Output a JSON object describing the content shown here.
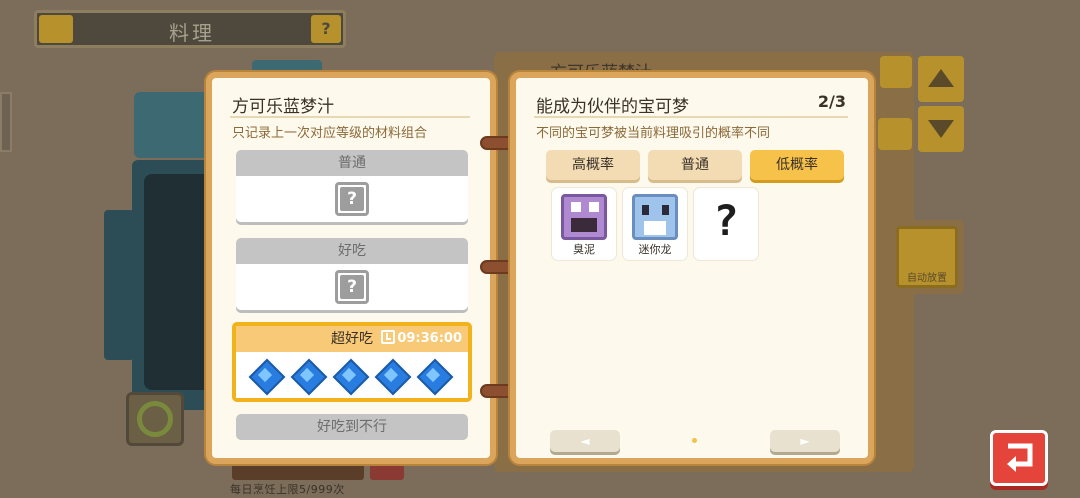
{
  "header": {
    "title": "料理",
    "help_label": "?"
  },
  "background": {
    "recipe_title": "方可乐蓝梦汁",
    "auto_place_label": "自动放置",
    "daily_limit": "每日烹饪上限5/999次"
  },
  "left_page": {
    "title": "方可乐蓝梦汁",
    "subtitle": "只记录上一次对应等级的材料组合",
    "ranks": [
      {
        "label": "普通",
        "content": "?"
      },
      {
        "label": "好吃",
        "content": "?"
      },
      {
        "label": "超好吃",
        "timer": "09:36:00",
        "ingredient_count": 5
      },
      {
        "label": "好吃到不行"
      }
    ]
  },
  "right_page": {
    "title": "能成为伙伴的宝可梦",
    "page_indicator": "2/3",
    "subtitle": "不同的宝可梦被当前料理吸引的概率不同",
    "tabs": [
      {
        "label": "高概率",
        "active": false
      },
      {
        "label": "普通",
        "active": false
      },
      {
        "label": "低概率",
        "active": true
      }
    ],
    "pokemon": [
      {
        "name": "臭泥",
        "icon": "muk-sprite"
      },
      {
        "name": "迷你龙",
        "icon": "dratini-sprite"
      },
      {
        "name": "",
        "icon": "unknown-question-mark",
        "mark": "?"
      }
    ],
    "nav": {
      "prev": "◄",
      "next": "►"
    }
  },
  "colors": {
    "book_border": "#dba55c",
    "selected": "#f2b21b",
    "back_button": "#e5443a"
  }
}
